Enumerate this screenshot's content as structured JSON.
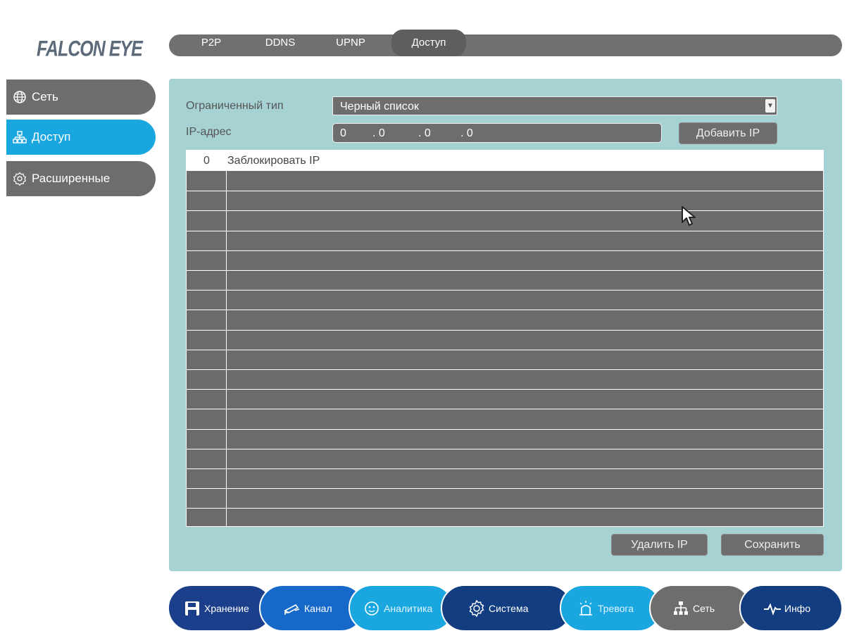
{
  "brand": {
    "logo_text": "FALCON EYE"
  },
  "tabs": [
    {
      "label": "P2P",
      "active": false
    },
    {
      "label": "DDNS",
      "active": false
    },
    {
      "label": "UPNP",
      "active": false
    },
    {
      "label": "Доступ",
      "active": true
    }
  ],
  "sidebar": {
    "items": [
      {
        "label": "Сеть",
        "icon": "globe-icon",
        "active": false
      },
      {
        "label": "Доступ",
        "icon": "network-icon",
        "active": true
      },
      {
        "label": "Расширенные",
        "icon": "settings-icon",
        "active": false
      }
    ]
  },
  "form": {
    "restricted_type_label": "Ограниченный тип",
    "restricted_type_value": "Черный список",
    "ip_label": "IP-адрес",
    "ip_octets": [
      "0",
      ".  0",
      ".  0",
      ".  0"
    ],
    "add_ip_button": "Добавить IP"
  },
  "table": {
    "header_index": "0",
    "header_label": "Заблокировать IP"
  },
  "actions": {
    "delete_ip_button": "Удалить IP",
    "save_button": "Сохранить"
  },
  "bottom_nav": [
    {
      "label": "Хранение",
      "icon": "save-icon",
      "color": "#1c3f8c"
    },
    {
      "label": "Канал",
      "icon": "camera-icon",
      "color": "#1769c9"
    },
    {
      "label": "Аналитика",
      "icon": "face-icon",
      "color": "#1aa7e0"
    },
    {
      "label": "Система",
      "icon": "gear-icon",
      "color": "#123d80"
    },
    {
      "label": "Тревога",
      "icon": "alarm-icon",
      "color": "#1aa7e0"
    },
    {
      "label": "Сеть",
      "icon": "network-icon",
      "color": "#6d6d6d"
    },
    {
      "label": "Инфо",
      "icon": "pulse-icon",
      "color": "#123d80"
    }
  ],
  "colors": {
    "accent": "#1aa7e0",
    "panel": "#a7d2d4",
    "control": "#6d6d6d"
  }
}
